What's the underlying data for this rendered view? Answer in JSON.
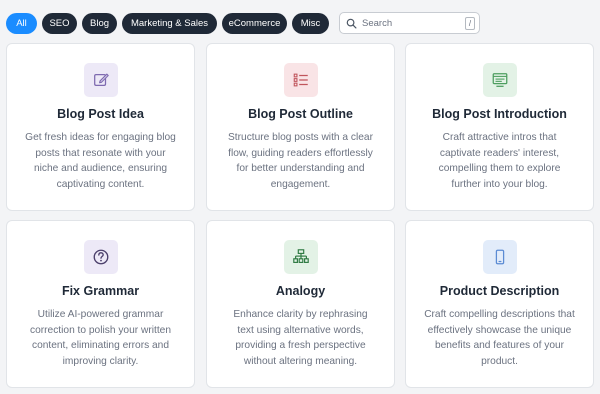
{
  "filters": {
    "tabs": [
      "All",
      "SEO",
      "Blog",
      "Marketing & Sales",
      "eCommerce",
      "Misc"
    ],
    "active": "All"
  },
  "search": {
    "placeholder": "Search",
    "value": "",
    "shortcut": "/"
  },
  "colors": {
    "accent": "#1a8cff",
    "pill_dark": "#1f2937",
    "icon_purple_bg": "#ede9f7",
    "icon_purple": "#7e6ab0",
    "icon_red_bg": "#f9e4e6",
    "icon_red": "#c0555c",
    "icon_green_bg": "#e3f2e6",
    "icon_green": "#4d9e5f",
    "icon_blue_bg": "#e2ecfa",
    "icon_blue": "#5b8bd4"
  },
  "cards": [
    {
      "title": "Blog Post Idea",
      "description": "Get fresh ideas for engaging blog posts that resonate with your niche and audience, ensuring captivating content.",
      "icon": "edit-icon"
    },
    {
      "title": "Blog Post Outline",
      "description": "Structure blog posts with a clear flow, guiding readers effortlessly for better understanding and engagement.",
      "icon": "list-icon"
    },
    {
      "title": "Blog Post Introduction",
      "description": "Craft attractive intros that captivate readers' interest, compelling them to explore further into your blog.",
      "icon": "window-icon"
    },
    {
      "title": "Fix Grammar",
      "description": "Utilize AI-powered grammar correction to polish your written content, eliminating errors and improving clarity.",
      "icon": "question-icon"
    },
    {
      "title": "Analogy",
      "description": "Enhance clarity by rephrasing text using alternative words, providing a fresh perspective without altering meaning.",
      "icon": "sitemap-icon"
    },
    {
      "title": "Product Description",
      "description": "Craft compelling descriptions that effectively showcase the unique benefits and features of your product.",
      "icon": "mobile-icon"
    }
  ]
}
